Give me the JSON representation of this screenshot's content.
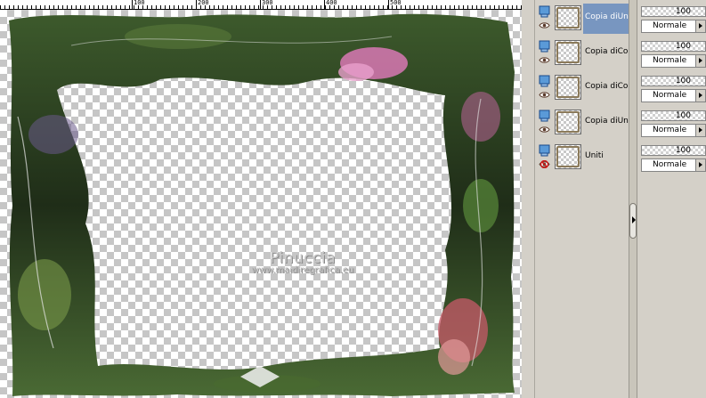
{
  "ruler": {
    "labels": [
      "100",
      "200",
      "300",
      "400",
      "500"
    ]
  },
  "watermark": {
    "name": "Pinuccia",
    "url": "www.maidiregrafica.eu"
  },
  "colors": {
    "selection": "#7896c0",
    "panel": "#d4d0c8",
    "frame_dark": "#2a3a24",
    "flowers_pink": "#d878b4"
  },
  "layers": [
    {
      "name": "Copia diUni",
      "selected": true,
      "visible": true,
      "opacity": "100",
      "blend": "Normale",
      "icon": "layer-raster-icon"
    },
    {
      "name": "Copia diCop",
      "selected": false,
      "visible": true,
      "opacity": "100",
      "blend": "Normale",
      "icon": "layer-raster-icon"
    },
    {
      "name": "Copia diCop",
      "selected": false,
      "visible": true,
      "opacity": "100",
      "blend": "Normale",
      "icon": "layer-raster-icon"
    },
    {
      "name": "Copia diUni",
      "selected": false,
      "visible": true,
      "opacity": "100",
      "blend": "Normale",
      "icon": "layer-raster-icon"
    },
    {
      "name": "Uniti",
      "selected": false,
      "visible": false,
      "opacity": "100",
      "blend": "Normale",
      "icon": "layer-raster-icon"
    }
  ]
}
